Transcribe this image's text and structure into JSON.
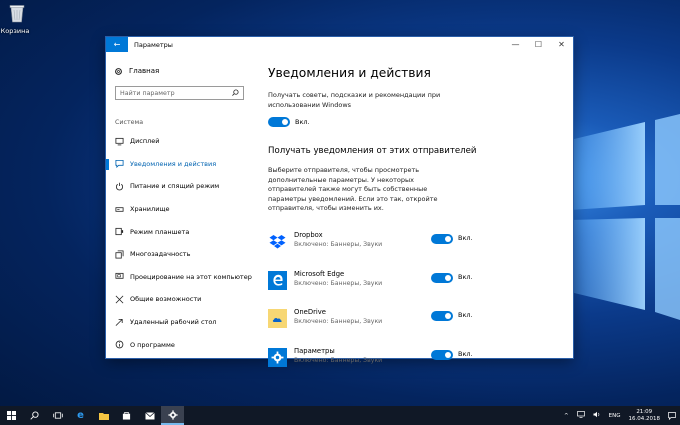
{
  "desktop": {
    "recycle_bin_label": "Корзина"
  },
  "window": {
    "title": "Параметры",
    "back_label": "←",
    "minimize": "—",
    "maximize": "☐",
    "close": "✕"
  },
  "sidebar": {
    "home_label": "Главная",
    "search_placeholder": "Найти параметр",
    "section_label": "Система",
    "items": [
      {
        "label": "Дисплей",
        "icon": "display-icon",
        "active": false
      },
      {
        "label": "Уведомления и действия",
        "icon": "notifications-icon",
        "active": true
      },
      {
        "label": "Питание и спящий режим",
        "icon": "power-icon",
        "active": false
      },
      {
        "label": "Хранилище",
        "icon": "storage-icon",
        "active": false
      },
      {
        "label": "Режим планшета",
        "icon": "tablet-icon",
        "active": false
      },
      {
        "label": "Многозадачность",
        "icon": "multitasking-icon",
        "active": false
      },
      {
        "label": "Проецирование на этот компьютер",
        "icon": "projecting-icon",
        "active": false
      },
      {
        "label": "Общие возможности",
        "icon": "shared-icon",
        "active": false
      },
      {
        "label": "Удаленный рабочий стол",
        "icon": "remote-desktop-icon",
        "active": false
      },
      {
        "label": "О программе",
        "icon": "about-icon",
        "active": false
      }
    ]
  },
  "main": {
    "title": "Уведомления и действия",
    "tips_text": "Получать советы, подсказки и рекомендации при использовании Windows",
    "tips_toggle_label": "Вкл.",
    "senders_heading": "Получать уведомления от этих отправителей",
    "senders_text": "Выберите отправителя, чтобы просмотреть дополнительные параметры. У некоторых отправителей также могут быть собственные параметры уведомлений. Если это так, откройте отправителя, чтобы изменить их.",
    "apps": [
      {
        "name": "Dropbox",
        "status": "Включено: Баннеры, Звуки",
        "toggle": "Вкл.",
        "icon": "dropbox-icon"
      },
      {
        "name": "Microsoft Edge",
        "status": "Включено: Баннеры, Звуки",
        "toggle": "Вкл.",
        "icon": "edge-icon"
      },
      {
        "name": "OneDrive",
        "status": "Включено: Баннеры, Звуки",
        "toggle": "Вкл.",
        "icon": "onedrive-icon"
      },
      {
        "name": "Параметры",
        "status": "Включено: Баннеры, Звуки",
        "toggle": "Вкл.",
        "icon": "settings-gear-icon"
      }
    ]
  },
  "taskbar": {
    "lang": "ENG",
    "time": "21:09",
    "date": "16.04.2018"
  },
  "colors": {
    "accent": "#0078d7",
    "taskbar": "#101826"
  }
}
